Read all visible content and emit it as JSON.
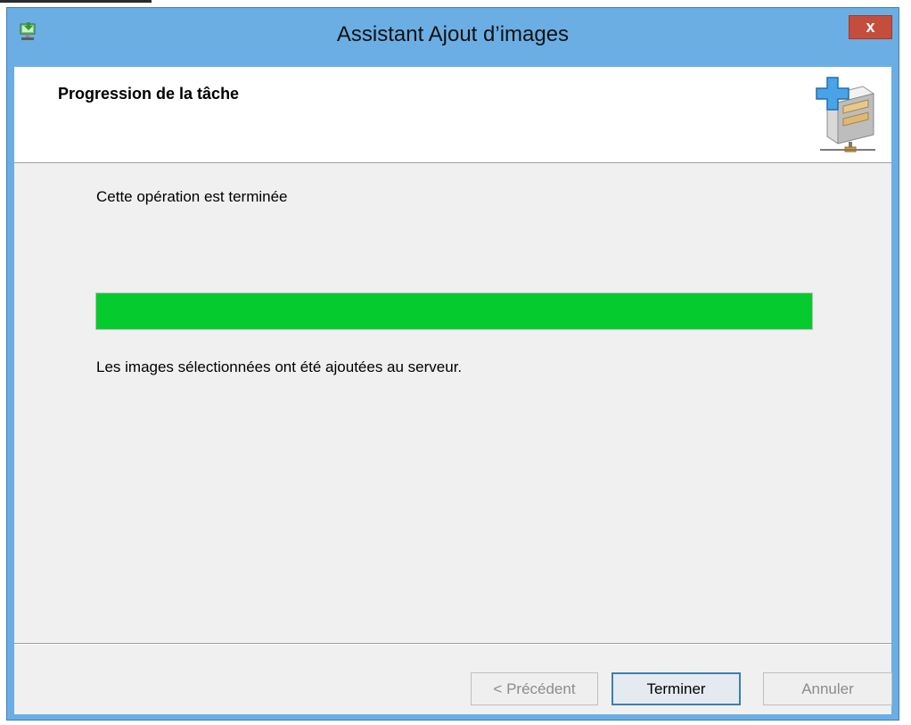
{
  "window": {
    "title": "Assistant Ajout d’images",
    "close_label": "x",
    "icon": "deployment-server-icon"
  },
  "header": {
    "title": "Progression de la tâche",
    "icon": "add-image-server-icon"
  },
  "content": {
    "status": "Cette opération est terminée",
    "progress_fraction": 1.0,
    "result_message": "Les images sélectionnées ont été ajoutées au serveur."
  },
  "buttons": {
    "previous": "< Précédent",
    "finish": "Terminer",
    "cancel": "Annuler"
  },
  "colors": {
    "titlebar": "#6aaee4",
    "close_button": "#c44e3b",
    "progress_fill": "#06cb2e",
    "client_background": "#f0f0f0"
  }
}
